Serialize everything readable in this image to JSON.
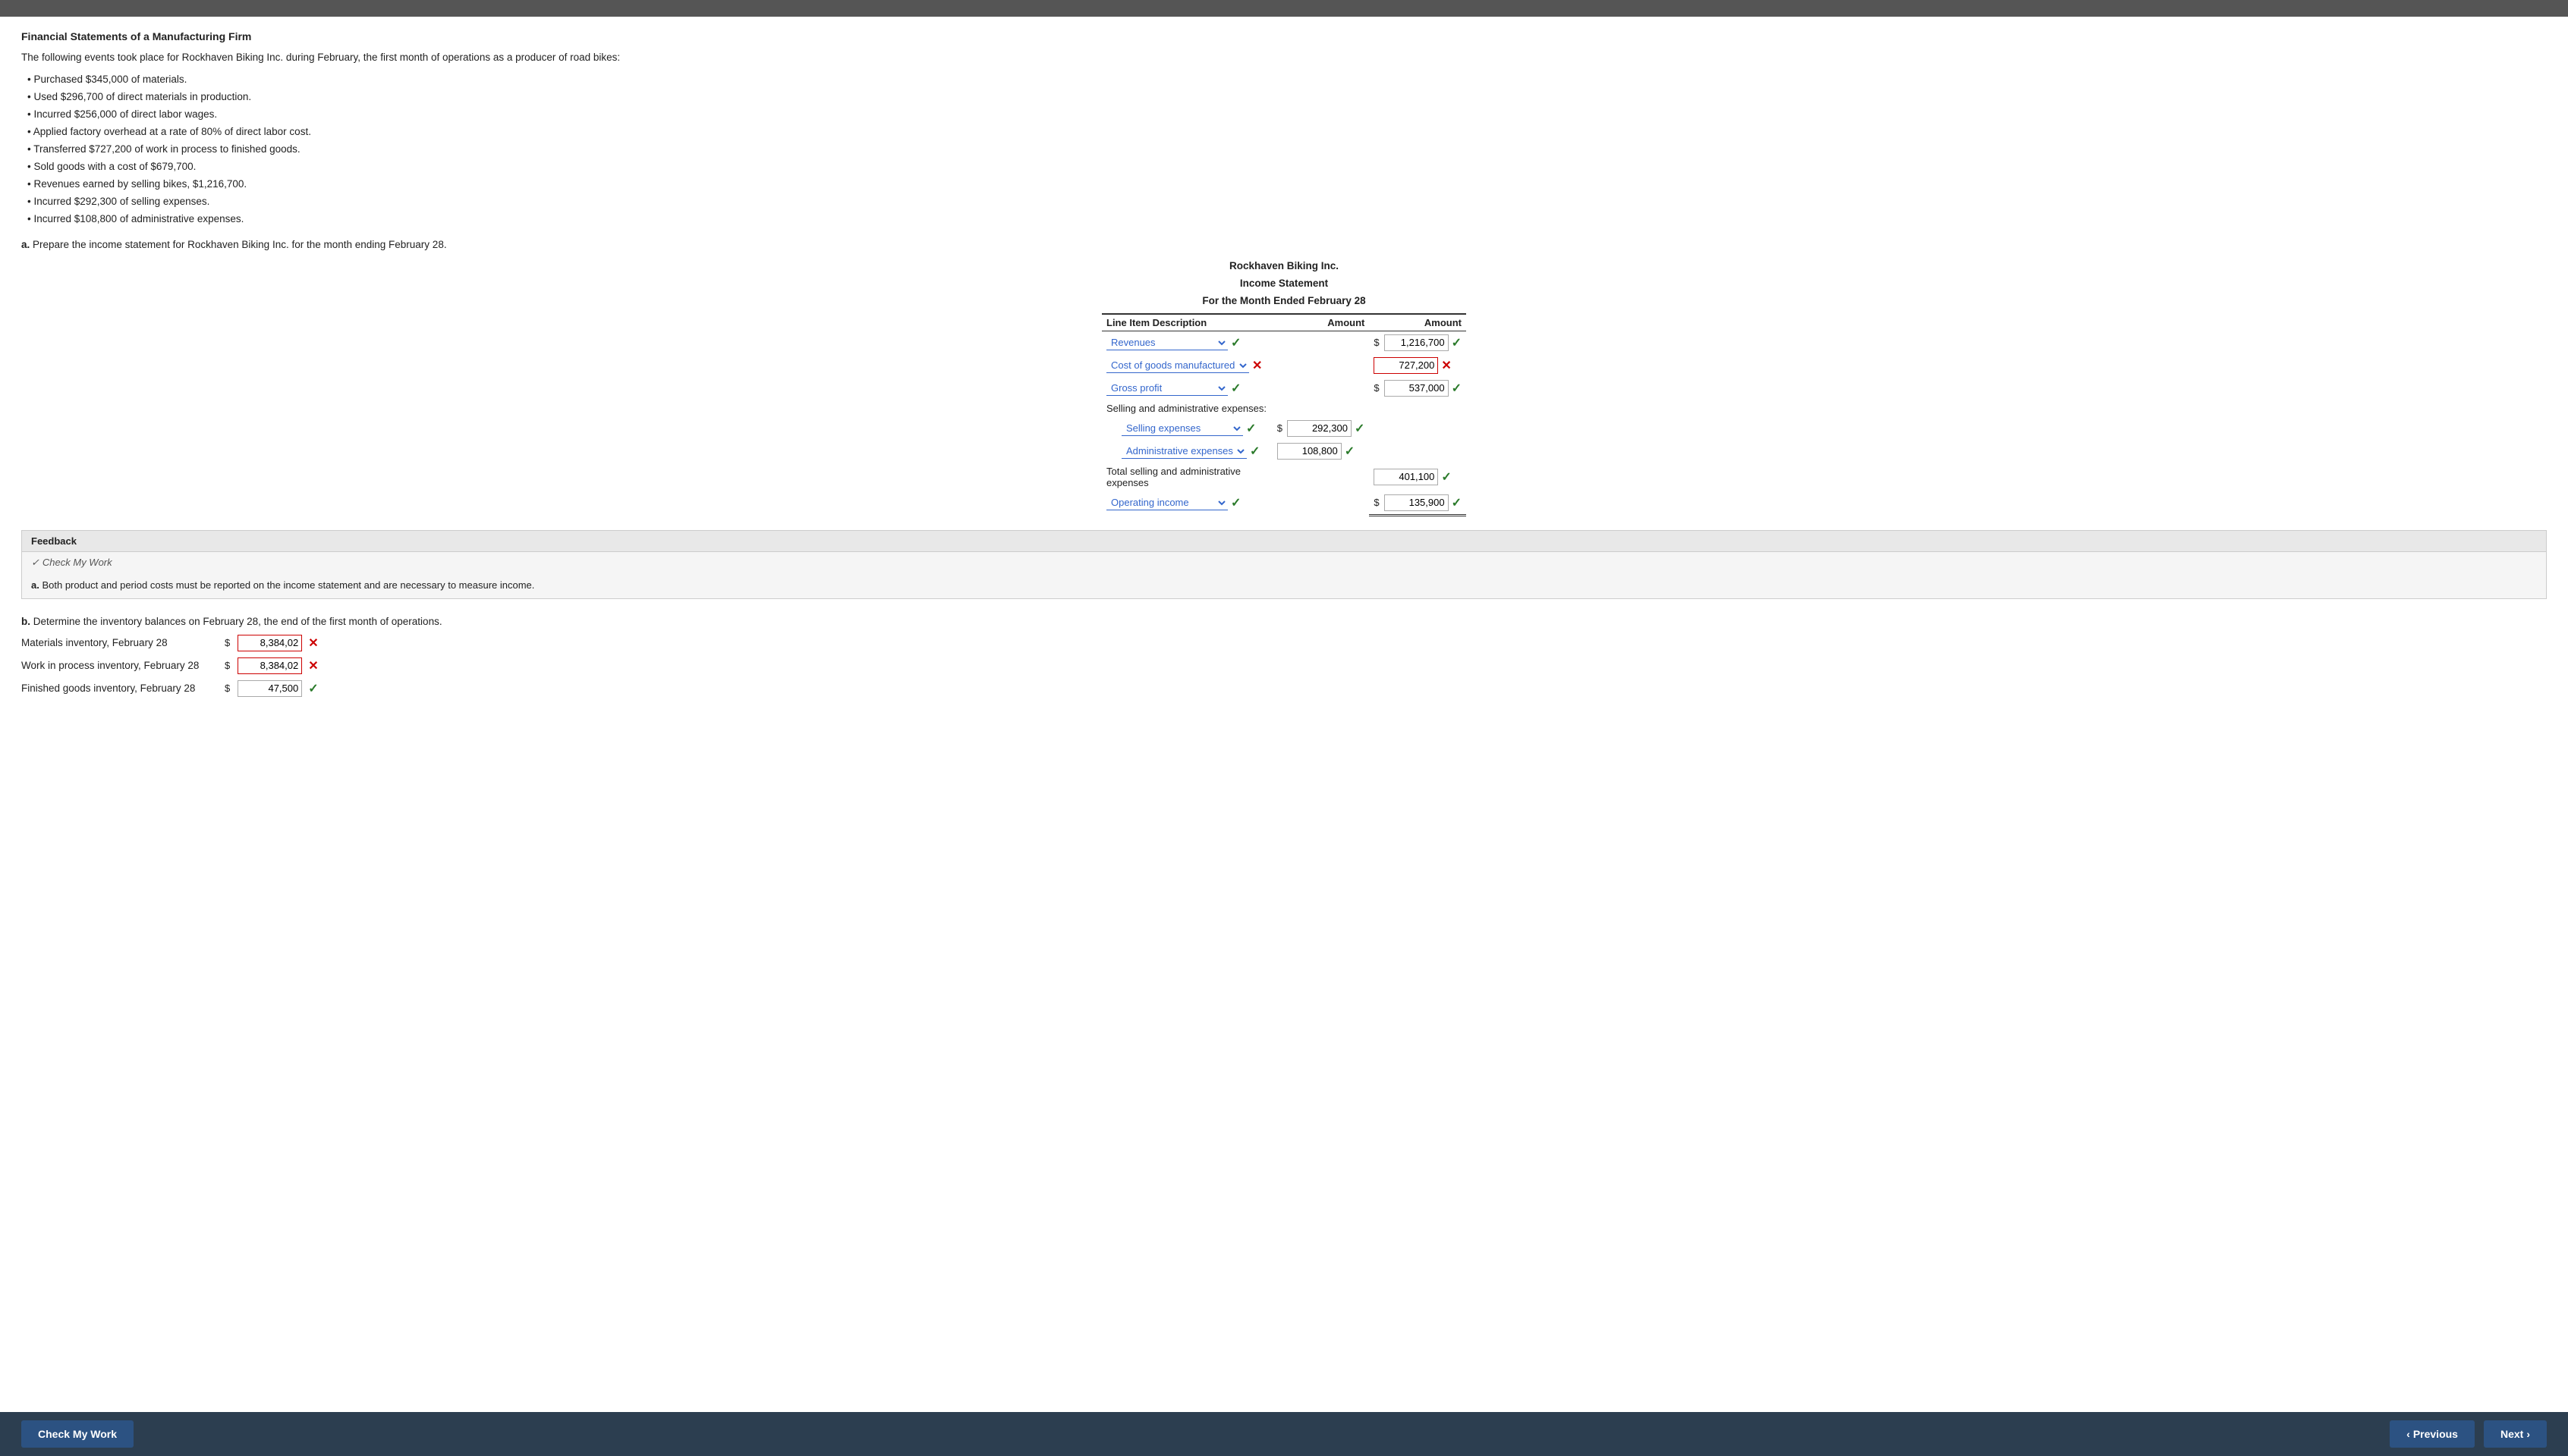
{
  "topbar": {},
  "header": {
    "title": "Financial Statements of a Manufacturing Firm"
  },
  "intro": {
    "description": "The following events took place for Rockhaven Biking Inc. during February, the first month of operations as a producer of road bikes:"
  },
  "bullets": [
    "Purchased $345,000 of materials.",
    "Used $296,700 of direct materials in production.",
    "Incurred $256,000 of direct labor wages.",
    "Applied factory overhead at a rate of 80% of direct labor cost.",
    "Transferred $727,200 of work in process to finished goods.",
    "Sold goods with a cost of $679,700.",
    "Revenues earned by selling bikes, $1,216,700.",
    "Incurred $292,300 of selling expenses.",
    "Incurred $108,800 of administrative expenses."
  ],
  "question_a": {
    "label": "a.",
    "text": "Prepare the income statement for Rockhaven Biking Inc. for the month ending February 28."
  },
  "statement": {
    "company": "Rockhaven Biking Inc.",
    "title": "Income Statement",
    "period": "For the Month Ended February 28",
    "col1": "Line Item Description",
    "col2": "Amount",
    "col3": "Amount",
    "rows": [
      {
        "id": "revenues",
        "label": "Revenues",
        "has_dropdown": true,
        "has_check": true,
        "check_type": "check",
        "dollar_sign": "$",
        "amount": "1,216,700",
        "amount_check": "check",
        "indented": false
      },
      {
        "id": "cost_of_goods",
        "label": "Cost of goods manufactured",
        "has_dropdown": true,
        "has_check": false,
        "check_type": "cross",
        "dollar_sign": "",
        "amount": "727,200",
        "amount_check": "cross",
        "indented": false
      },
      {
        "id": "gross_profit",
        "label": "Gross profit",
        "has_dropdown": true,
        "has_check": true,
        "check_type": "check",
        "dollar_sign": "$",
        "amount": "537,000",
        "amount_check": "check",
        "indented": false
      }
    ],
    "selling_admin_header": "Selling and administrative expenses:",
    "selling_rows": [
      {
        "id": "selling_expenses",
        "label": "Selling expenses",
        "has_dropdown": true,
        "check_type": "check",
        "dollar_sign": "$",
        "amount": "292,300",
        "amount_check": "check"
      },
      {
        "id": "admin_expenses",
        "label": "Administrative expenses",
        "has_dropdown": true,
        "check_type": "check",
        "dollar_sign": "",
        "amount": "108,800",
        "amount_check": "check"
      }
    ],
    "total_selling_label": "Total selling and administrative expenses",
    "total_selling_amount": "401,100",
    "total_selling_check": "check",
    "operating_income": {
      "label": "Operating income",
      "has_dropdown": true,
      "check_type": "check",
      "dollar_sign": "$",
      "amount": "135,900",
      "amount_check": "check"
    }
  },
  "feedback": {
    "header": "Feedback",
    "check_work_label": "✓ Check My Work",
    "item_a_label": "a.",
    "item_a_text": "Both product and period costs must be reported on the income statement and are necessary to measure income."
  },
  "question_b": {
    "label": "b.",
    "text": "Determine the inventory balances on February 28, the end of the first month of operations."
  },
  "inventory": [
    {
      "label": "Materials inventory, February 28",
      "dollar_sign": "$",
      "value": "8,384,02",
      "check_type": "cross"
    },
    {
      "label": "Work in process inventory, February 28",
      "dollar_sign": "$",
      "value": "8,384,02",
      "check_type": "cross"
    },
    {
      "label": "Finished goods inventory, February 28",
      "dollar_sign": "$",
      "value": "47,500",
      "check_type": "check"
    }
  ],
  "bottom_bar": {
    "check_my_work": "Check My Work",
    "previous": "Previous",
    "next": "Next"
  }
}
